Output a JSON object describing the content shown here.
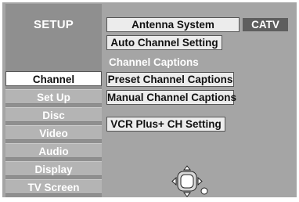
{
  "menu": {
    "title": "SETUP",
    "items": [
      {
        "label": "Channel",
        "selected": true
      },
      {
        "label": "Set Up",
        "selected": false
      },
      {
        "label": "Disc",
        "selected": false
      },
      {
        "label": "Video",
        "selected": false
      },
      {
        "label": "Audio",
        "selected": false
      },
      {
        "label": "Display",
        "selected": false
      },
      {
        "label": "TV Screen",
        "selected": false
      }
    ]
  },
  "panel": {
    "antenna_system_label": "Antenna System",
    "antenna_system_value": "CATV",
    "auto_channel_label": "Auto Channel Setting",
    "captions_heading": "Channel Captions",
    "preset_captions_label": "Preset Channel Captions",
    "manual_captions_label": "Manual Channel Captions",
    "vcr_plus_label": "VCR Plus+ CH Setting"
  },
  "icons": {
    "navigation": "directional-pad-icon",
    "enter": "enter-dot-icon"
  },
  "colors": {
    "background": "#a5a5a5",
    "menu_column": "#8f8f8f",
    "menu_item": "#b4b4b4",
    "selected_item": "#ffffff",
    "button": "#ececec",
    "value_box": "#5e5e5e"
  }
}
